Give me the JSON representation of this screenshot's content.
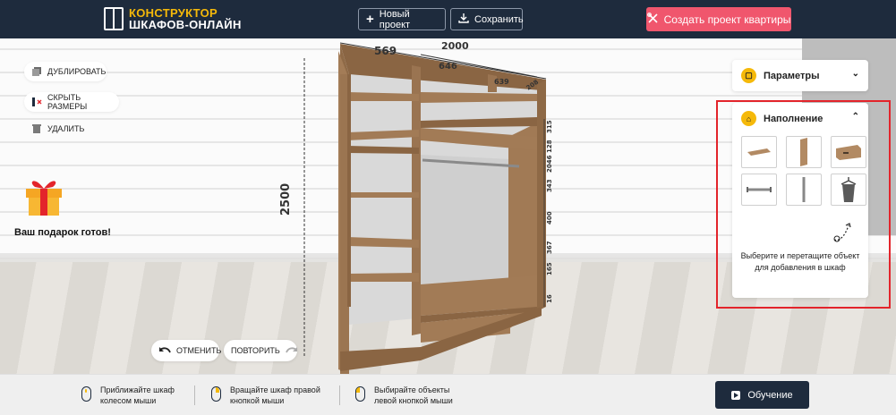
{
  "header": {
    "logo_line1": "КОНСТРУКТОР",
    "logo_line2": "ШКАФОВ-ОНЛАЙН",
    "new_project": "Новый проект",
    "save": "Сохранить",
    "create_flat": "Создать проект квартиры"
  },
  "tools": {
    "duplicate": "ДУБЛИРОВАТЬ",
    "hide_sizes": "СКРЫТЬ РАЗМЕРЫ",
    "delete": "УДАЛИТЬ"
  },
  "gift": {
    "label": "Ваш подарок готов!"
  },
  "history": {
    "undo": "ОТМЕНИТЬ",
    "redo": "ПОВТОРИТЬ"
  },
  "dimensions": {
    "width_total": "2000",
    "height_total": "2500",
    "depth": "569",
    "section_width_1": "646",
    "section_width_2": "639",
    "side_partial": "208",
    "heights": [
      "315",
      "128",
      "2046",
      "343",
      "400",
      "367",
      "165",
      "16"
    ]
  },
  "panels": {
    "params_title": "Параметры",
    "fill_title": "Наполнение",
    "fill_items": [
      "shelf-icon",
      "side-panel-icon",
      "drawer-icon",
      "rod-icon",
      "vertical-rod-icon",
      "hanger-icon"
    ],
    "hint": "Выберите и перетащите объект для добавления в шкаф"
  },
  "footer": {
    "tip1_l1": "Приближайте шкаф",
    "tip1_l2": "колесом мыши",
    "tip2_l1": "Вращайте шкаф правой",
    "tip2_l2": "кнопкой мыши",
    "tip3_l1": "Выбирайте объекты",
    "tip3_l2": "левой кнопкой мыши",
    "learn": "Обучение"
  },
  "colors": {
    "header_bg": "#1e2b3d",
    "accent_yellow": "#f5b90a",
    "accent_pink": "#f0566d",
    "wood": "#9a7451",
    "highlight": "#e3242b"
  }
}
